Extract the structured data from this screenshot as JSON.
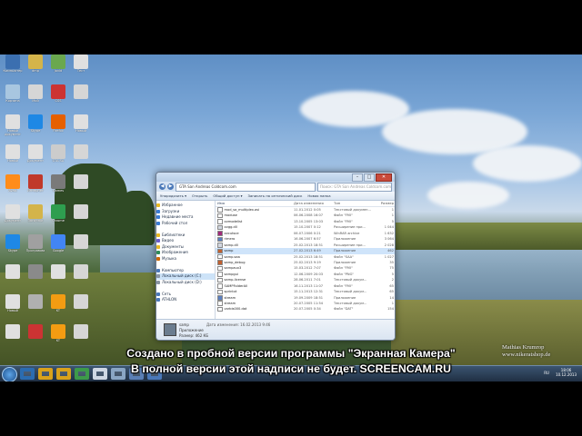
{
  "explorer": {
    "address": "GTA San Andreas Coldcom.com",
    "search_placeholder": "Поиск: GTA San Andreas Coldcom.com",
    "toolbar": [
      "Упорядочить ▾",
      "Открыть",
      "Общий доступ ▾",
      "Записать на оптический диск",
      "Новая папка"
    ],
    "nav": [
      {
        "label": "Избранное",
        "color": "#e8b923",
        "sel": false
      },
      {
        "label": "Загрузки",
        "color": "#3a7bd5",
        "sel": false
      },
      {
        "label": "Недавние места",
        "color": "#3a7bd5",
        "sel": false
      },
      {
        "label": "Рабочий стол",
        "color": "#3a7bd5",
        "sel": false
      },
      {
        "label": "",
        "color": "transparent",
        "sel": false
      },
      {
        "label": "Библиотеки",
        "color": "#e8b923",
        "sel": false
      },
      {
        "label": "Видео",
        "color": "#6a5acd",
        "sel": false
      },
      {
        "label": "Документы",
        "color": "#e8b923",
        "sel": false
      },
      {
        "label": "Изображения",
        "color": "#2e8b57",
        "sel": false
      },
      {
        "label": "Музыка",
        "color": "#cc6600",
        "sel": false
      },
      {
        "label": "",
        "color": "transparent",
        "sel": false
      },
      {
        "label": "Компьютер",
        "color": "#4a78b8",
        "sel": false
      },
      {
        "label": "Локальный диск (C:)",
        "color": "#8a94a3",
        "sel": true
      },
      {
        "label": "Локальный диск (D:)",
        "color": "#8a94a3",
        "sel": false
      },
      {
        "label": "",
        "color": "transparent",
        "sel": false
      },
      {
        "label": "Сеть",
        "color": "#4a78b8",
        "sel": false
      },
      {
        "label": "ATHLON",
        "color": "#4a78b8",
        "sel": false
      }
    ],
    "columns": {
      "name": "Имя",
      "date": "Дата изменения",
      "type": "Тип",
      "size": "Размер"
    },
    "files": [
      {
        "name": "mod_sa_multiplex.asi",
        "date": "11.01.2012 0:05",
        "type": "Текстовый докумен...",
        "size": "1",
        "color": "#ffffff",
        "sel": false
      },
      {
        "name": "moduse",
        "date": "06.06.2008 16:07",
        "type": "Файл \"FMI\"",
        "size": "1",
        "color": "#ffffff",
        "sel": false
      },
      {
        "name": "ovmodelist",
        "date": "13.10.2005 13:03",
        "type": "Файл \"FMI\"",
        "size": "5",
        "color": "#ffffff",
        "sel": false
      },
      {
        "name": "ovgg.dll",
        "date": "15.10.2007 0:12",
        "type": "Расширение при...",
        "size": "1 044",
        "color": "#d0d6e0",
        "sel": false
      },
      {
        "name": "ovcutsce",
        "date": "06.07.2006 0:21",
        "type": "WinRAR archive",
        "size": "1 632",
        "color": "#a02a7a",
        "sel": false
      },
      {
        "name": "rimero",
        "date": "16.06.2007 6:57",
        "type": "Приложение",
        "size": "3 064",
        "color": "#5a7fc0",
        "sel": false
      },
      {
        "name": "samp.dll",
        "date": "25.02.2013 18:51",
        "type": "Расширение при...",
        "size": "2 028",
        "color": "#d0d6e0",
        "sel": false
      },
      {
        "name": "samp",
        "date": "27.02.2013 6:49",
        "type": "Приложение",
        "size": "462",
        "color": "#c06030",
        "sel": true
      },
      {
        "name": "samp.saa",
        "date": "25.02.2013 18:51",
        "type": "Файл \"SAA\"",
        "size": "1 027",
        "color": "#ffffff",
        "sel": false
      },
      {
        "name": "samp_debug",
        "date": "25.02.2013 9:19",
        "type": "Приложение",
        "size": "35",
        "color": "#c06030",
        "sel": false
      },
      {
        "name": "sampaux3",
        "date": "15.03.2012 7:07",
        "type": "Файл \"FMI\"",
        "size": "75",
        "color": "#ffffff",
        "sel": false
      },
      {
        "name": "sampgui",
        "date": "12.06.2009 20:03",
        "type": "Файл \"PNG\"",
        "size": "5",
        "color": "#ffffff",
        "sel": false
      },
      {
        "name": "samp-license",
        "date": "28.06.2011 7:01",
        "type": "Текстовый докум...",
        "size": "2",
        "color": "#ffffff",
        "sel": false
      },
      {
        "name": "SAMPFolderAll",
        "date": "16.11.2013 11:07",
        "type": "Файл \"FMI\"",
        "size": "65",
        "color": "#ffffff",
        "sel": false
      },
      {
        "name": "sprintxt",
        "date": "15.11.2013 12:31",
        "type": "Текстовый докум...",
        "size": "65",
        "color": "#ffffff",
        "sel": false
      },
      {
        "name": "stream",
        "date": "19.09.2009 18:51",
        "type": "Приложение",
        "size": "14",
        "color": "#5a7fc0",
        "sel": false
      },
      {
        "name": "stream",
        "date": "20.07.2005 11:54",
        "type": "Текстовый докум...",
        "size": "1",
        "color": "#ffffff",
        "sel": false
      },
      {
        "name": "vorbis000.dat",
        "date": "20.07.2005 0:34",
        "type": "Файл \"DAT\"",
        "size": "154",
        "color": "#ffffff",
        "sel": false
      }
    ],
    "details": {
      "name": "samp",
      "type": "Приложение",
      "date": "Дата изменения: 16.02.2013 9:46",
      "size": "Размер: 462 КБ"
    }
  },
  "desktop_icons": [
    {
      "label": "Компьютер",
      "color": "#3b6fb0"
    },
    {
      "label": "dmp",
      "color": "#d4b44a"
    },
    {
      "label": "Jovid",
      "color": "#6aa84f"
    },
    {
      "label": "Тест",
      "color": "#e0e0e0"
    },
    {
      "label": "Корзина",
      "color": "#a8c6e0"
    },
    {
      "label": "Мой",
      "color": "#d6d6d6"
    },
    {
      "label": "CSS",
      "color": "#cc3333"
    },
    {
      "label": "",
      "color": "#d6d6d6"
    },
    {
      "label": "Новый документ",
      "color": "#e0e0e0"
    },
    {
      "label": "Skype",
      "color": "#1e88e5"
    },
    {
      "label": "Firefox",
      "color": "#e66000"
    },
    {
      "label": "Новый",
      "color": "#e0e0e0"
    },
    {
      "label": "Новый",
      "color": "#e0e0e0"
    },
    {
      "label": "Документ",
      "color": "#e0e0e0"
    },
    {
      "label": "GTA SA",
      "color": "#cccccc"
    },
    {
      "label": "",
      "color": "#d6d6d6"
    },
    {
      "label": "Avast",
      "color": "#ff8c1a"
    },
    {
      "label": "Интернет",
      "color": "#c0392b"
    },
    {
      "label": "Games",
      "color": "#7a7a7a"
    },
    {
      "label": "",
      "color": "#d6d6d6"
    },
    {
      "label": "Документ",
      "color": "#e0e0e0"
    },
    {
      "label": "Загрузки",
      "color": "#d4b44a"
    },
    {
      "label": "Chrome",
      "color": "#2e9e4f"
    },
    {
      "label": "",
      "color": "#d6d6d6"
    },
    {
      "label": "Skype",
      "color": "#1e88e5"
    },
    {
      "label": "Программа",
      "color": "#a0a0a0"
    },
    {
      "label": "Google",
      "color": "#4285f4"
    },
    {
      "label": "",
      "color": "#d6d6d6"
    },
    {
      "label": "",
      "color": "#e0e0e0"
    },
    {
      "label": "",
      "color": "#8a8a8a"
    },
    {
      "label": "",
      "color": "#e0e0e0"
    },
    {
      "label": "",
      "color": "#d6d6d6"
    },
    {
      "label": "Новый",
      "color": "#e0e0e0"
    },
    {
      "label": "",
      "color": "#b0b0b0"
    },
    {
      "label": "KT",
      "color": "#f39c12"
    },
    {
      "label": "",
      "color": "#d6d6d6"
    },
    {
      "label": "",
      "color": "#e0e0e0"
    },
    {
      "label": "",
      "color": "#cc3333"
    },
    {
      "label": "KT",
      "color": "#f39c12"
    },
    {
      "label": "",
      "color": "#d6d6d6"
    }
  ],
  "taskbar": {
    "items": [
      "#2b6cb0",
      "#d9a21b",
      "#d9a21b",
      "#3d9a4a",
      "#cfd8e3",
      "#8aa6c4",
      "#5a7fb5",
      "#4a78b8"
    ],
    "lang": "RU",
    "time": "18:06",
    "date": "10.12.2013"
  },
  "watermark": {
    "line1": "Создано в пробной версии программы \"Экранная Камера\"",
    "line2": "В полной версии этой надписи не будет. SCREENCAM.RU"
  },
  "photo_credit": {
    "line1": "Mathias Krumrop",
    "line2": "www.nikeratshop.de"
  }
}
